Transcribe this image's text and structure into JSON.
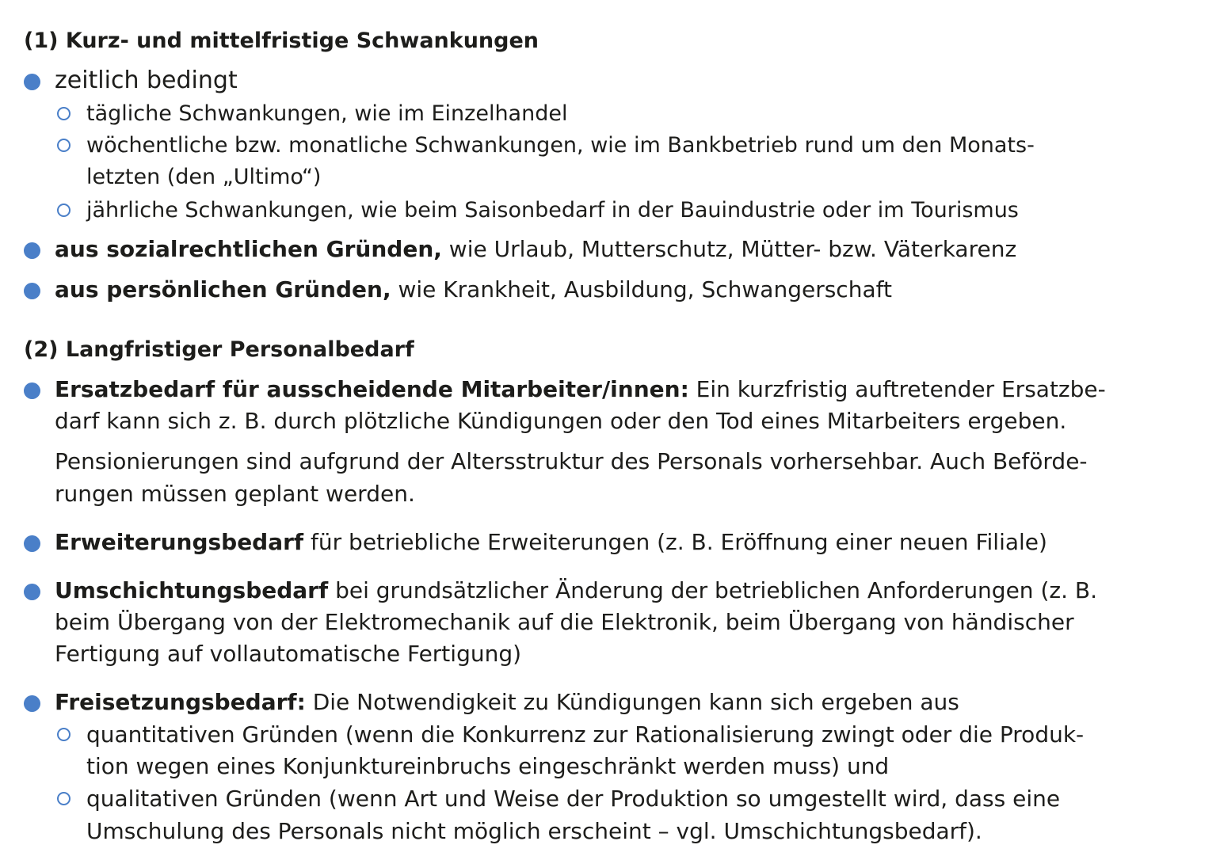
{
  "section1": {
    "heading": "(1) Kurz- und mittelfristige Schwankungen",
    "zeitlich": {
      "label": "zeitlich bedingt",
      "items": [
        {
          "lines": [
            "tägliche Schwankungen, wie im Einzelhandel"
          ]
        },
        {
          "lines": [
            "wöchentliche bzw. monatliche Schwankungen, wie im Bankbetrieb rund um den Monats-",
            "letzten (den „Ultimo“)"
          ]
        },
        {
          "lines": [
            "jährliche Schwankungen, wie beim Saisonbedarf in der Bauindustrie oder im Tourismus"
          ]
        }
      ]
    },
    "sozial": {
      "term": "aus sozialrechtlichen Gründen,",
      "text": " wie Urlaub, Mutterschutz, Mütter- bzw. Väterkarenz"
    },
    "persoenlich": {
      "term": "aus persönlichen Gründen,",
      "text": " wie Krankheit, Ausbildung, Schwangerschaft"
    }
  },
  "section2": {
    "heading": "(2) Langfristiger Personalbedarf",
    "ersatz": {
      "term": "Ersatzbedarf für ausscheidende Mitarbeiter/innen:",
      "line1_text": " Ein kurzfristig auftretender Ersatzbe-",
      "line2": "darf kann sich z. B. durch plötzliche Kündigungen oder den Tod eines Mitarbeiters ergeben.",
      "para2_line1": "Pensionierungen sind aufgrund der Altersstruktur des Personals vorhersehbar. Auch Beförde-",
      "para2_line2": "rungen müssen geplant werden."
    },
    "erweiterung": {
      "term": "Erweiterungsbedarf",
      "text": " für betriebliche Erweiterungen (z. B. Eröffnung einer neuen Filiale)"
    },
    "umschichtung": {
      "term": "Umschichtungsbedarf",
      "line1_text": " bei grundsätzlicher Änderung der betrieblichen Anforderungen (z. B.",
      "line2": "beim Übergang von der Elektromechanik auf die Elektronik, beim Übergang von händischer",
      "line3": "Fertigung auf vollautomatische Fertigung)"
    },
    "freisetzung": {
      "term": "Freisetzungsbedarf:",
      "text": " Die Notwendigkeit zu Kündigungen kann sich ergeben aus",
      "items": [
        {
          "lines": [
            "quantitativen Gründen (wenn die Konkurrenz zur Rationalisierung zwingt oder die Produk-",
            "tion wegen eines Konjunktureinbruchs eingeschränkt werden muss) und"
          ]
        },
        {
          "lines": [
            "qualitativen Gründen (wenn Art und Weise der Produktion so umgestellt wird, dass eine",
            "Umschulung des Personals nicht möglich erscheint – vgl. Umschichtungsbedarf)."
          ]
        }
      ]
    }
  }
}
